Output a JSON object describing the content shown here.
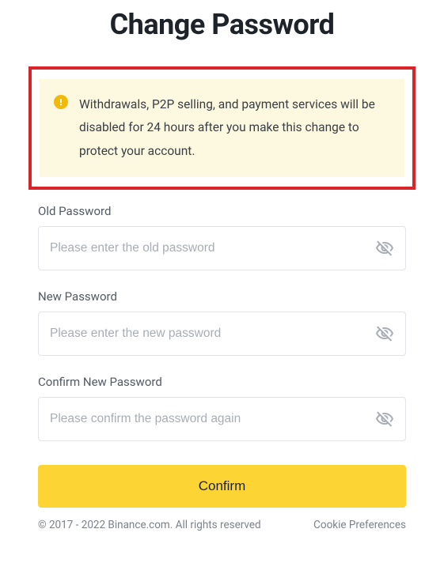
{
  "title": "Change Password",
  "warning": {
    "text": "Withdrawals, P2P selling, and payment services will be disabled for 24 hours after you make this change to protect your account."
  },
  "form": {
    "old_password": {
      "label": "Old Password",
      "placeholder": "Please enter the old password",
      "value": ""
    },
    "new_password": {
      "label": "New Password",
      "placeholder": "Please enter the new password",
      "value": ""
    },
    "confirm_password": {
      "label": "Confirm New Password",
      "placeholder": "Please confirm the password again",
      "value": ""
    }
  },
  "button": {
    "confirm_label": "Confirm"
  },
  "footer": {
    "copyright": "© 2017 - 2022 Binance.com. All rights reserved",
    "cookie_link": "Cookie Preferences"
  }
}
